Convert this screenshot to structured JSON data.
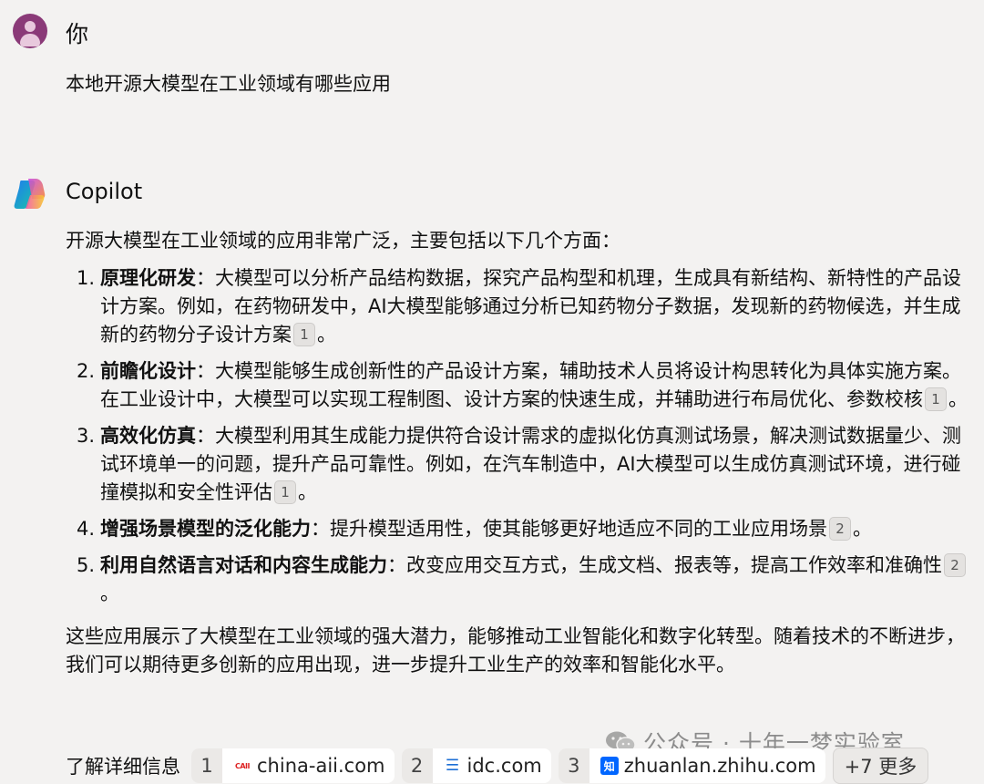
{
  "user": {
    "name": "你",
    "message": "本地开源大模型在工业领域有哪些应用"
  },
  "copilot": {
    "name": "Copilot",
    "intro": "开源大模型在工业领域的应用非常广泛，主要包括以下几个方面：",
    "items": [
      {
        "num": "1.",
        "title": "原理化研发",
        "text": "：大模型可以分析产品结构数据，探究产品构型和机理，生成具有新结构、新特性的产品设计方案。例如，在药物研发中，AI大模型能够通过分析已知药物分子数据，发现新的药物候选，并生成新的药物分子设计方案",
        "cite": "1",
        "end": "。"
      },
      {
        "num": "2.",
        "title": "前瞻化设计",
        "text": "：大模型能够生成创新性的产品设计方案，辅助技术人员将设计构思转化为具体实施方案。在工业设计中，大模型可以实现工程制图、设计方案的快速生成，并辅助进行布局优化、参数校核",
        "cite": "1",
        "end": "。"
      },
      {
        "num": "3.",
        "title": "高效化仿真",
        "text": "：大模型利用其生成能力提供符合设计需求的虚拟化仿真测试场景，解决测试数据量少、测试环境单一的问题，提升产品可靠性。例如，在汽车制造中，AI大模型可以生成仿真测试环境，进行碰撞模拟和安全性评估",
        "cite": "1",
        "end": "。"
      },
      {
        "num": "4.",
        "title": "增强场景模型的泛化能力",
        "text": "：提升模型适用性，使其能够更好地适应不同的工业应用场景",
        "cite": "2",
        "end": "。"
      },
      {
        "num": "5.",
        "title": "利用自然语言对话和内容生成能力",
        "text": "：改变应用交互方式，生成文档、报表等，提高工作效率和准确性",
        "cite": "2",
        "end": "。"
      }
    ],
    "conclusion": "这些应用展示了大模型在工业领域的强大潜力，能够推动工业智能化和数字化转型。随着技术的不断进步，我们可以期待更多创新的应用出现，进一步提升工业生产的效率和智能化水平。"
  },
  "sources": {
    "label": "了解详细信息",
    "items": [
      {
        "num": "1",
        "domain": "china-aii.com",
        "favicon": "CAII"
      },
      {
        "num": "2",
        "domain": "idc.com",
        "favicon": "idc-icon"
      },
      {
        "num": "3",
        "domain": "zhuanlan.zhihu.com",
        "favicon": "知"
      }
    ],
    "more": "+7 更多"
  },
  "watermark": "公众号 · 十年一梦实验室",
  "colors": {
    "background": "#f3f2f1",
    "avatar": "#8a3a78",
    "zhihu": "#0066ff"
  }
}
